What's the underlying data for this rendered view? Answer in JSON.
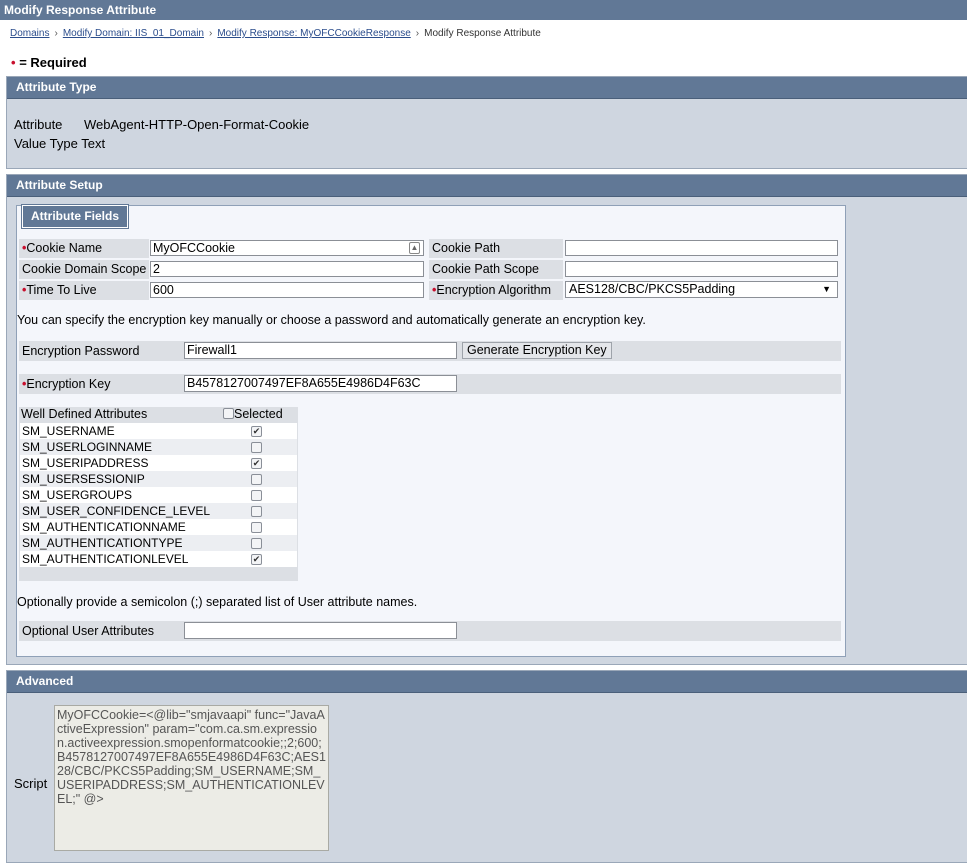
{
  "window": {
    "title": "Modify Response Attribute"
  },
  "breadcrumb": {
    "items": [
      "Domains",
      "Modify Domain: IIS_01_Domain",
      "Modify Response: MyOFCCookieResponse"
    ],
    "current": "Modify Response Attribute",
    "separator": "›"
  },
  "required_note": {
    "dot": "•",
    "text": "= Required"
  },
  "attribute_type": {
    "heading": "Attribute Type",
    "attribute_label": "Attribute",
    "attribute_value": "WebAgent-HTTP-Open-Format-Cookie",
    "value_type_label": "Value Type",
    "value_type_value": "Text"
  },
  "attribute_setup": {
    "heading": "Attribute Setup",
    "fields_legend": "Attribute Fields",
    "cookie_name_label": "Cookie Name",
    "cookie_name_value": "MyOFCCookie",
    "cookie_path_label": "Cookie Path",
    "cookie_path_value": "",
    "cookie_domain_scope_label": "Cookie Domain Scope",
    "cookie_domain_scope_value": "2",
    "cookie_path_scope_label": "Cookie Path Scope",
    "cookie_path_scope_value": "",
    "time_to_live_label": "Time To Live",
    "time_to_live_value": "600",
    "encryption_algorithm_label": "Encryption Algorithm",
    "encryption_algorithm_value": "AES128/CBC/PKCS5Padding",
    "encryption_note": "You can specify the encryption key manually or choose a password and automatically generate an encryption key.",
    "encryption_password_label": "Encryption Password",
    "encryption_password_value": "Firewall1",
    "generate_button": "Generate Encryption Key",
    "encryption_key_label": "Encryption Key",
    "encryption_key_value": "B4578127007497EF8A655E4986D4F63C",
    "well_defined": {
      "header": "Well Defined Attributes",
      "selected_header": "Selected",
      "rows": [
        {
          "name": "SM_USERNAME",
          "checked": true
        },
        {
          "name": "SM_USERLOGINNAME",
          "checked": false
        },
        {
          "name": "SM_USERIPADDRESS",
          "checked": true
        },
        {
          "name": "SM_USERSESSIONIP",
          "checked": false
        },
        {
          "name": "SM_USERGROUPS",
          "checked": false
        },
        {
          "name": "SM_USER_CONFIDENCE_LEVEL",
          "checked": false
        },
        {
          "name": "SM_AUTHENTICATIONNAME",
          "checked": false
        },
        {
          "name": "SM_AUTHENTICATIONTYPE",
          "checked": false
        },
        {
          "name": "SM_AUTHENTICATIONLEVEL",
          "checked": true
        }
      ]
    },
    "optional_note": "Optionally provide a semicolon (;) separated list of User attribute names.",
    "optional_user_label": "Optional User Attributes",
    "optional_user_value": ""
  },
  "advanced": {
    "heading": "Advanced",
    "script_label": "Script",
    "script_value": "MyOFCCookie=<@lib=\"smjavaapi\" func=\"JavaActiveExpression\" param=\"com.ca.sm.expression.activeexpression.smopenformatcookie;;2;600;B4578127007497EF8A655E4986D4F63C;AES128/CBC/PKCS5Padding;SM_USERNAME;SM_USERIPADDRESS;SM_AUTHENTICATIONLEVEL;\" @>"
  },
  "colors": {
    "header": "#617896",
    "section_bg": "#cfd6e0",
    "required_dot": "#c8102e",
    "link": "#2b4d8c"
  }
}
